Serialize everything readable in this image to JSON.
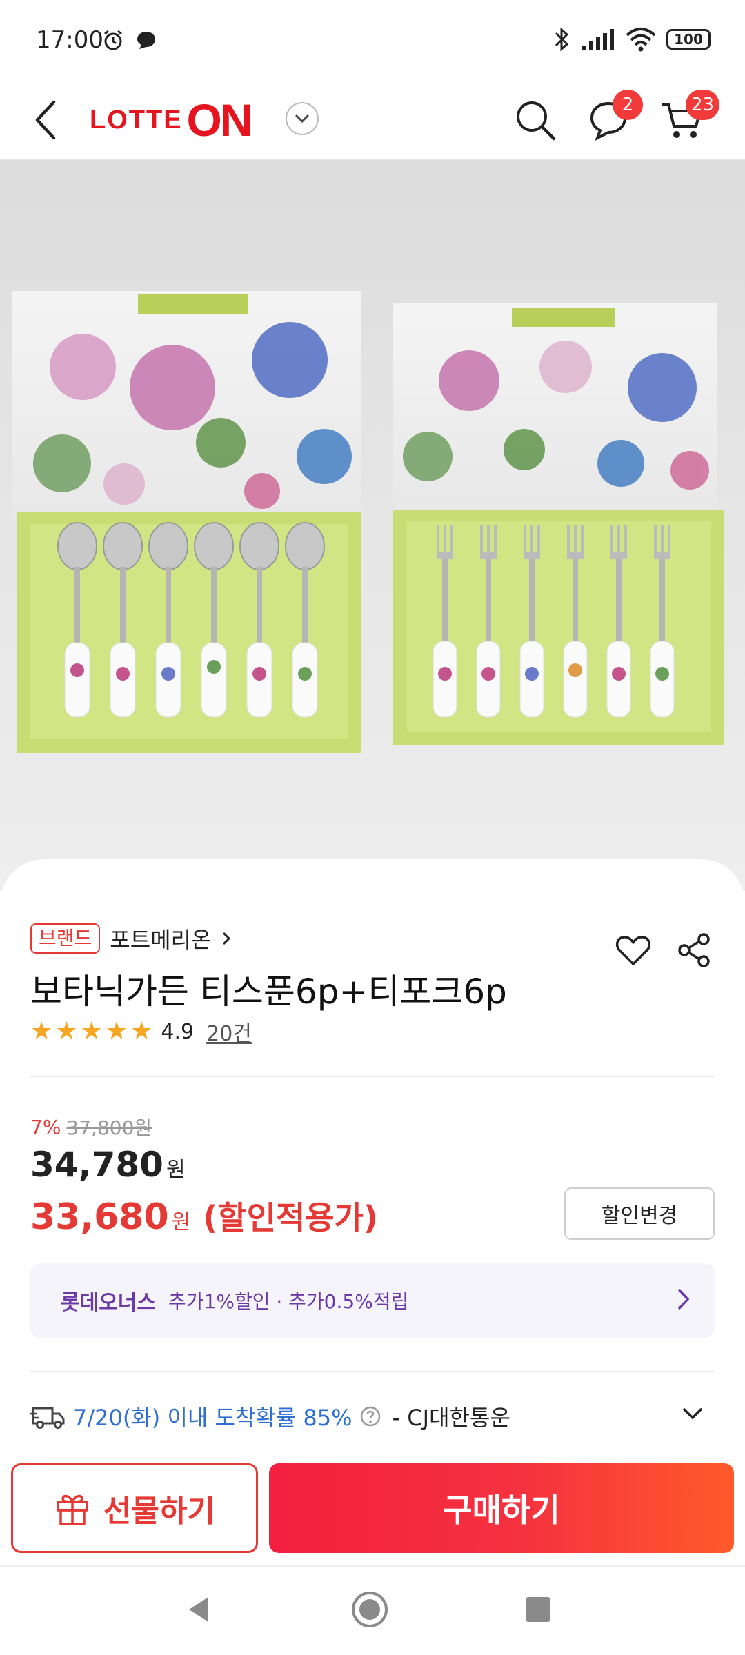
{
  "status_bar": {
    "time": "17:00",
    "battery": "100"
  },
  "app_bar": {
    "logo_lotte": "LOTTE",
    "logo_on": "ON",
    "chat_badge": "2",
    "cart_badge": "23"
  },
  "product": {
    "brand_tag": "브랜드",
    "brand_name": "포트메리온",
    "title": "보타닉가든 티스푼6p+티포크6p",
    "rating": "4.9",
    "review_count": "20건",
    "stars": 5
  },
  "price": {
    "discount_rate": "7%",
    "original_price": "37,800원",
    "sale_price": "34,780",
    "won": "원",
    "final_price": "33,680",
    "final_won": "원",
    "final_label": "(할인적용가)",
    "change_button": "할인변경"
  },
  "benefit": {
    "name": "롯데오너스",
    "description": "추가1%할인 · 추가0.5%적립"
  },
  "shipping": {
    "arrival": "7/20(화) 이내 도착확률 85%",
    "carrier": "- CJ대한통운"
  },
  "actions": {
    "gift_label": "선물하기",
    "buy_label": "구매하기"
  },
  "colors": {
    "brand_red": "#e5141f",
    "accent_red": "#e53935",
    "benefit_purple": "#6b3aa8",
    "shipping_blue": "#2f6fd3",
    "star_yellow": "#f5a623",
    "tray_green": "#c6dc76"
  }
}
